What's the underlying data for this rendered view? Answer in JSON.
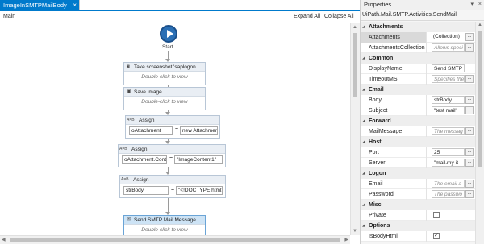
{
  "document_tab": {
    "title": "ImageInSMTPMailBody",
    "close_glyph": "×"
  },
  "designer": {
    "breadcrumb": "Main",
    "expand_all": "Expand All",
    "collapse_all": "Collapse All",
    "start_label": "Start",
    "activities": [
      {
        "title": "Take screenshot 'saplogon.",
        "hint": "Double-click to view",
        "icon": "camera-icon"
      },
      {
        "title": "Save Image",
        "hint": "Double-click to view",
        "icon": "save-icon"
      },
      {
        "title": "Assign",
        "to": "oAttachment",
        "value": "new Attachment(\"I",
        "icon": "assign-icon"
      },
      {
        "title": "Assign",
        "to": "oAttachment.Cont",
        "value": "\"ImageContent1\"",
        "icon": "assign-icon"
      },
      {
        "title": "Assign",
        "to": "strBody",
        "value": "\"<!DOCTYPE html>",
        "icon": "assign-icon"
      },
      {
        "title": "Send SMTP Mail Message",
        "hint": "Double-click to view",
        "icon": "mail-icon"
      }
    ],
    "icon_glyphs": {
      "assign": "A=B",
      "camera": "◙",
      "save": "▣",
      "mail": "✉"
    }
  },
  "properties": {
    "title": "Properties",
    "activity_type": "UiPath.Mail.SMTP.Activities.SendMail",
    "ellipsis": "...",
    "categories": [
      {
        "name": "Attachments",
        "props": [
          {
            "name": "Attachments",
            "value": "(Collection)",
            "kind": "plain",
            "button": true,
            "selected": true
          },
          {
            "name": "AttachmentsCollection",
            "value": "Allows speci",
            "kind": "placeholder",
            "button": true
          }
        ]
      },
      {
        "name": "Common",
        "props": [
          {
            "name": "DisplayName",
            "value": "Send SMTP Mail",
            "kind": "text",
            "button": false
          },
          {
            "name": "TimeoutMS",
            "value": "Specifies the",
            "kind": "placeholder",
            "button": true
          }
        ]
      },
      {
        "name": "Email",
        "props": [
          {
            "name": "Body",
            "value": "strBody",
            "kind": "text",
            "button": true
          },
          {
            "name": "Subject",
            "value": "\"test mail\"",
            "kind": "text",
            "button": true
          }
        ]
      },
      {
        "name": "Forward",
        "props": [
          {
            "name": "MailMessage",
            "value": "The messag",
            "kind": "placeholder",
            "button": true
          }
        ]
      },
      {
        "name": "Host",
        "props": [
          {
            "name": "Port",
            "value": "25",
            "kind": "text",
            "button": true
          },
          {
            "name": "Server",
            "value": "\"mail.my-it-",
            "kind": "text",
            "button": true
          }
        ]
      },
      {
        "name": "Logon",
        "props": [
          {
            "name": "Email",
            "value": "The email a",
            "kind": "placeholder",
            "button": true
          },
          {
            "name": "Password",
            "value": "The passwo",
            "kind": "placeholder",
            "button": true
          }
        ]
      },
      {
        "name": "Misc",
        "props": [
          {
            "name": "Private",
            "kind": "checkbox",
            "checked": false
          }
        ]
      },
      {
        "name": "Options",
        "props": [
          {
            "name": "IsBodyHtml",
            "kind": "checkbox",
            "checked": true
          }
        ]
      }
    ]
  }
}
